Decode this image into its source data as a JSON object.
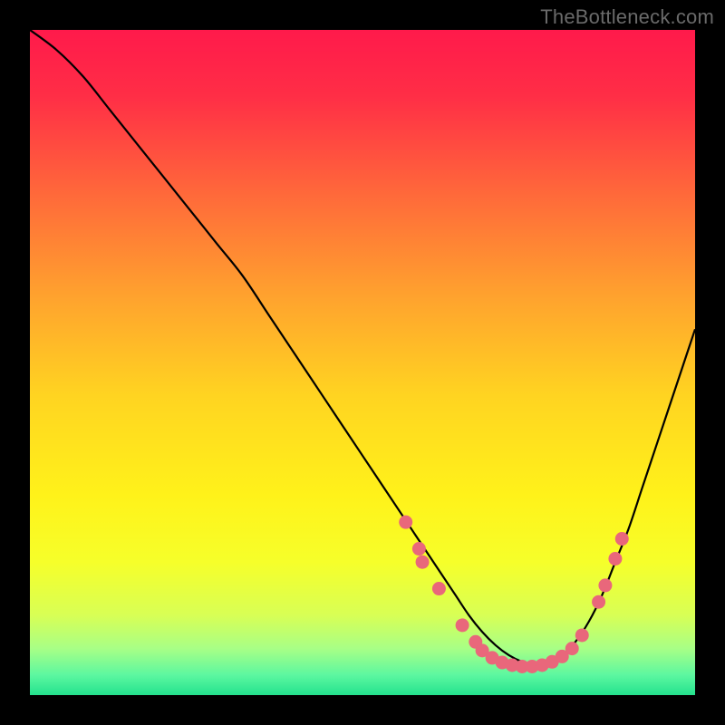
{
  "watermark": "TheBottleneck.com",
  "colors": {
    "background": "#000000",
    "curve_stroke": "#000000",
    "dot_fill": "#e9677b",
    "gradient_stops": [
      {
        "offset": 0.0,
        "color": "#ff1a4b"
      },
      {
        "offset": 0.1,
        "color": "#ff2e46"
      },
      {
        "offset": 0.25,
        "color": "#ff6a3a"
      },
      {
        "offset": 0.4,
        "color": "#ffa22e"
      },
      {
        "offset": 0.55,
        "color": "#ffd421"
      },
      {
        "offset": 0.7,
        "color": "#fff21a"
      },
      {
        "offset": 0.8,
        "color": "#f6ff2a"
      },
      {
        "offset": 0.88,
        "color": "#d8ff55"
      },
      {
        "offset": 0.93,
        "color": "#a8ff86"
      },
      {
        "offset": 0.97,
        "color": "#5cf7a0"
      },
      {
        "offset": 1.0,
        "color": "#24e28e"
      }
    ]
  },
  "chart_data": {
    "type": "line",
    "title": "",
    "xlabel": "",
    "ylabel": "",
    "xlim": [
      0,
      100
    ],
    "ylim": [
      0,
      100
    ],
    "series": [
      {
        "name": "bottleneck-curve",
        "x": [
          0,
          4,
          8,
          12,
          16,
          20,
          24,
          28,
          32,
          36,
          40,
          44,
          48,
          52,
          56,
          58,
          60,
          62,
          64,
          66,
          68,
          70,
          72,
          74,
          76,
          78,
          80,
          82,
          84,
          86,
          88,
          90,
          92,
          94,
          96,
          98,
          100
        ],
        "y": [
          100,
          97,
          93,
          88,
          83,
          78,
          73,
          68,
          63,
          57,
          51,
          45,
          39,
          33,
          27,
          24,
          21,
          18,
          15,
          12,
          9.5,
          7.5,
          6,
          5,
          4.5,
          4.8,
          6,
          8,
          11,
          15,
          20,
          25,
          31,
          37,
          43,
          49,
          55
        ]
      }
    ],
    "dots": {
      "name": "highlight-dots",
      "points": [
        {
          "x": 56.5,
          "y": 26
        },
        {
          "x": 58.5,
          "y": 22
        },
        {
          "x": 59.0,
          "y": 20
        },
        {
          "x": 61.5,
          "y": 16
        },
        {
          "x": 65.0,
          "y": 10.5
        },
        {
          "x": 67.0,
          "y": 8.0
        },
        {
          "x": 68.0,
          "y": 6.7
        },
        {
          "x": 69.5,
          "y": 5.6
        },
        {
          "x": 71.0,
          "y": 4.9
        },
        {
          "x": 72.5,
          "y": 4.5
        },
        {
          "x": 74.0,
          "y": 4.3
        },
        {
          "x": 75.5,
          "y": 4.3
        },
        {
          "x": 77.0,
          "y": 4.5
        },
        {
          "x": 78.5,
          "y": 5.0
        },
        {
          "x": 80.0,
          "y": 5.8
        },
        {
          "x": 81.5,
          "y": 7.0
        },
        {
          "x": 83.0,
          "y": 9.0
        },
        {
          "x": 85.5,
          "y": 14.0
        },
        {
          "x": 86.5,
          "y": 16.5
        },
        {
          "x": 88.0,
          "y": 20.5
        },
        {
          "x": 89.0,
          "y": 23.5
        }
      ]
    }
  }
}
